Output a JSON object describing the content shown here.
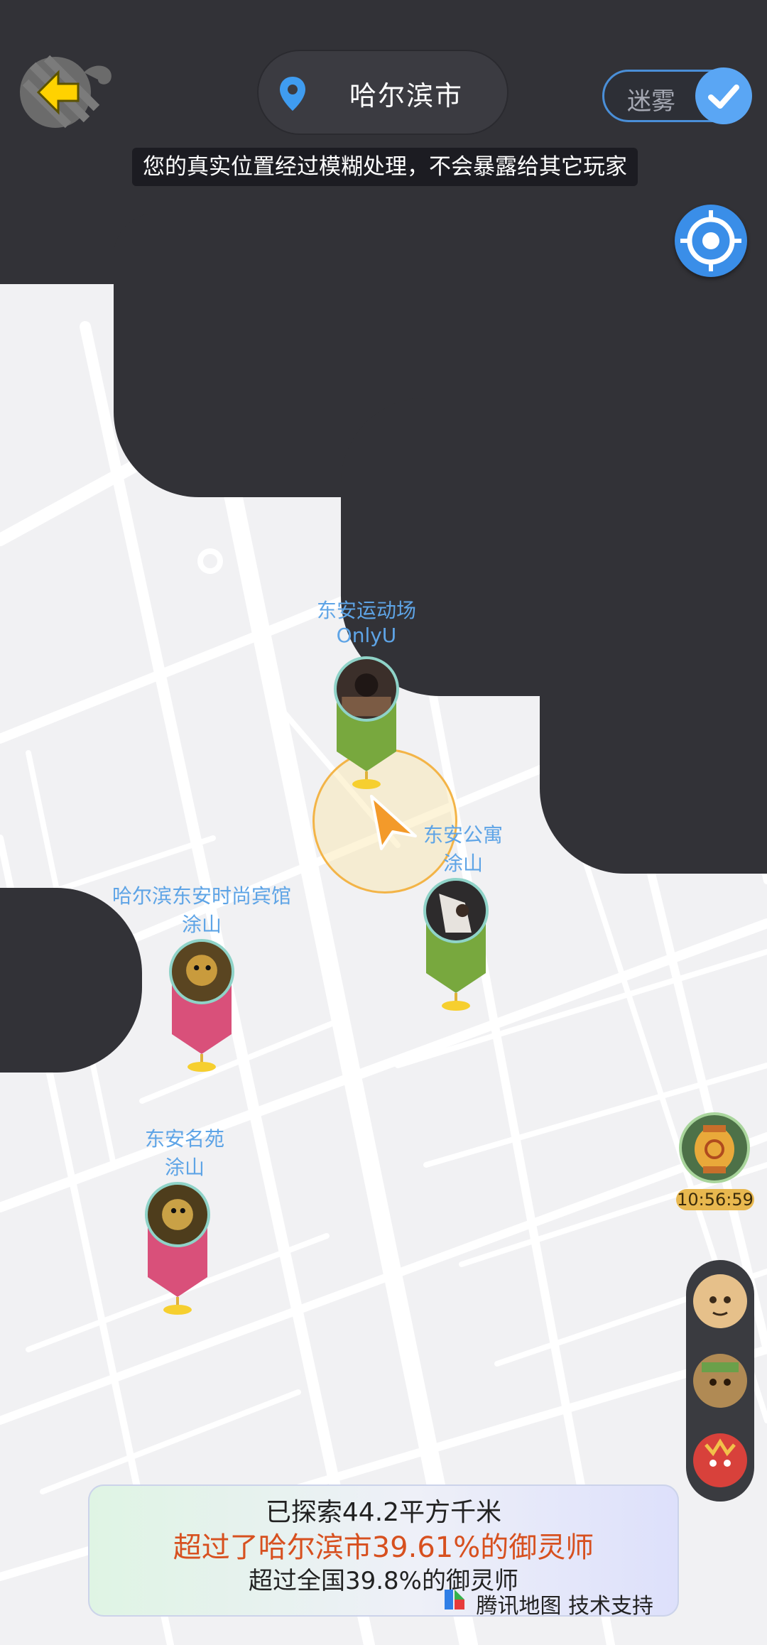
{
  "header": {
    "city": "哈尔滨市",
    "fog_toggle_label": "迷雾",
    "privacy_notice": "您的真实位置经过模糊处理，不会暴露给其它玩家"
  },
  "markers": [
    {
      "place": "东安运动场",
      "player": "OnlyU",
      "color": "#78a83e"
    },
    {
      "place": "东安公寓",
      "player": "涂山",
      "color": "#78a83e"
    },
    {
      "place": "哈尔滨东安时尚宾馆",
      "player": "涂山",
      "color": "#d9507a"
    },
    {
      "place": "东安名苑",
      "player": "涂山",
      "color": "#d9507a"
    }
  ],
  "timer": {
    "text": "10:56:59"
  },
  "stats": {
    "explored": "已探索44.2平方千米",
    "city_rank": "超过了哈尔滨市39.61%的御灵师",
    "national_rank": "超过全国39.8%的御灵师",
    "credit": "腾讯地图 技术支持"
  },
  "icons": {
    "back": "back-arrow-icon",
    "pin": "location-pin-icon",
    "check": "checkmark-icon",
    "locate": "locate-target-icon",
    "navigation": "navigation-arrow-icon",
    "map_logo": "tencent-map-icon"
  },
  "colors": {
    "fog": "#323237",
    "map": "#f1f1f3",
    "accent_blue": "#3a8ee8",
    "highlight_orange": "#d7501f"
  }
}
